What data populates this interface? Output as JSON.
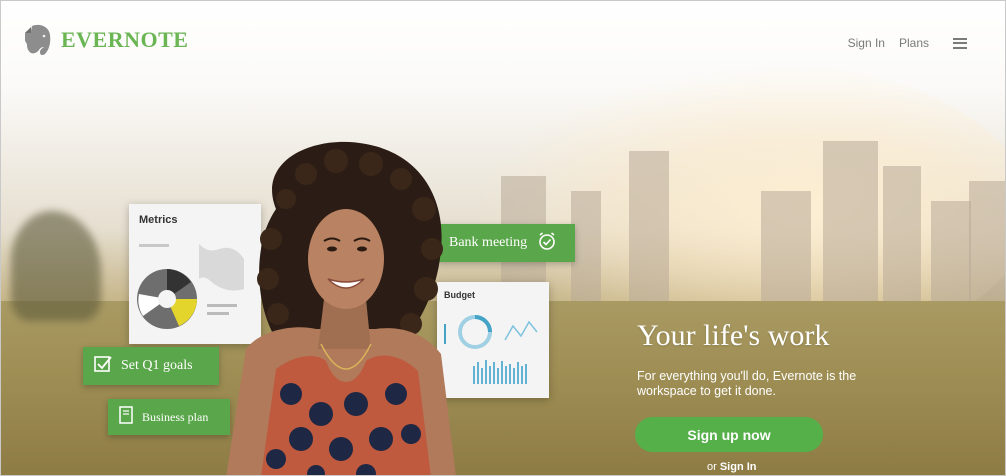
{
  "brand": {
    "name": "EVERNOTE",
    "color": "#6bb553",
    "logo_icon": "elephant-icon"
  },
  "nav": {
    "sign_in": "Sign In",
    "plans": "Plans",
    "menu_icon": "hamburger-icon"
  },
  "cards": {
    "metrics_title": "Metrics",
    "budget_title": "Budget",
    "bank_meeting": "Bank meeting",
    "set_goals": "Set Q1 goals",
    "business_plan": "Business plan"
  },
  "hero": {
    "headline": "Your life's work",
    "subcopy": "For everything you'll do, Evernote is the workspace to get it done.",
    "cta": "Sign up now",
    "or_text": "or",
    "sign_in_link": "Sign In"
  },
  "colors": {
    "accent_green": "#55b04a",
    "card_green": "#5aa64a"
  }
}
